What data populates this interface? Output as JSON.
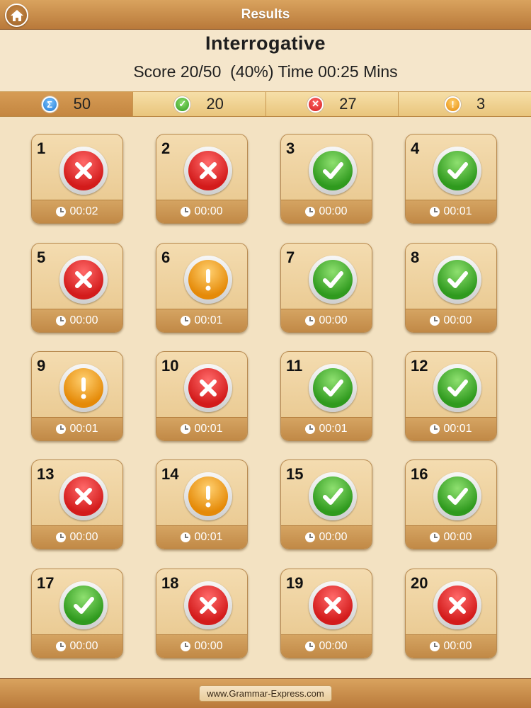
{
  "topbar": {
    "title": "Results",
    "home_icon": "home-icon"
  },
  "header": {
    "title": "Interrogative",
    "score_text": "Score 20/50",
    "percent_text": "  (40%) ",
    "time_text": "Time 00:25 Mins"
  },
  "stats": [
    {
      "icon": "sigma-icon",
      "value": "50",
      "color": "#2f8fe0"
    },
    {
      "icon": "check-icon",
      "value": "20",
      "color": "#3aa528"
    },
    {
      "icon": "x-icon",
      "value": "27",
      "color": "#e02626"
    },
    {
      "icon": "exclamation-icon",
      "value": "3",
      "color": "#f0a020"
    }
  ],
  "tiles": [
    {
      "num": "1",
      "status": "wrong",
      "time": "00:02"
    },
    {
      "num": "2",
      "status": "wrong",
      "time": "00:00"
    },
    {
      "num": "3",
      "status": "right",
      "time": "00:00"
    },
    {
      "num": "4",
      "status": "right",
      "time": "00:01"
    },
    {
      "num": "5",
      "status": "wrong",
      "time": "00:00"
    },
    {
      "num": "6",
      "status": "skip",
      "time": "00:01"
    },
    {
      "num": "7",
      "status": "right",
      "time": "00:00"
    },
    {
      "num": "8",
      "status": "right",
      "time": "00:00"
    },
    {
      "num": "9",
      "status": "skip",
      "time": "00:01"
    },
    {
      "num": "10",
      "status": "wrong",
      "time": "00:01"
    },
    {
      "num": "11",
      "status": "right",
      "time": "00:01"
    },
    {
      "num": "12",
      "status": "right",
      "time": "00:01"
    },
    {
      "num": "13",
      "status": "wrong",
      "time": "00:00"
    },
    {
      "num": "14",
      "status": "skip",
      "time": "00:01"
    },
    {
      "num": "15",
      "status": "right",
      "time": "00:00"
    },
    {
      "num": "16",
      "status": "right",
      "time": "00:00"
    },
    {
      "num": "17",
      "status": "right",
      "time": "00:00"
    },
    {
      "num": "18",
      "status": "wrong",
      "time": "00:00"
    },
    {
      "num": "19",
      "status": "wrong",
      "time": "00:00"
    },
    {
      "num": "20",
      "status": "wrong",
      "time": "00:00"
    }
  ],
  "footer": {
    "link": "www.Grammar-Express.com"
  }
}
